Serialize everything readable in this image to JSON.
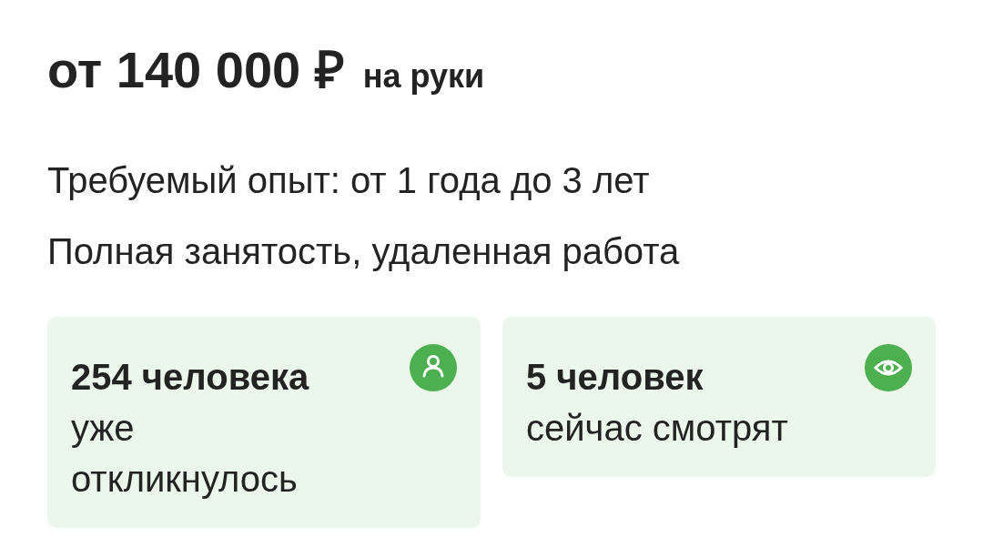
{
  "salary": {
    "amount": "от 140 000 ₽",
    "suffix": "на руки"
  },
  "details": [
    "Требуемый опыт: от 1 года до 3 лет",
    "Полная занятость, удаленная работа"
  ],
  "stats": [
    {
      "kind": "person",
      "count": "254 человека",
      "text": "уже откликнулось"
    },
    {
      "kind": "eye",
      "count": "5 человек",
      "text": "сейчас смотрят"
    }
  ]
}
